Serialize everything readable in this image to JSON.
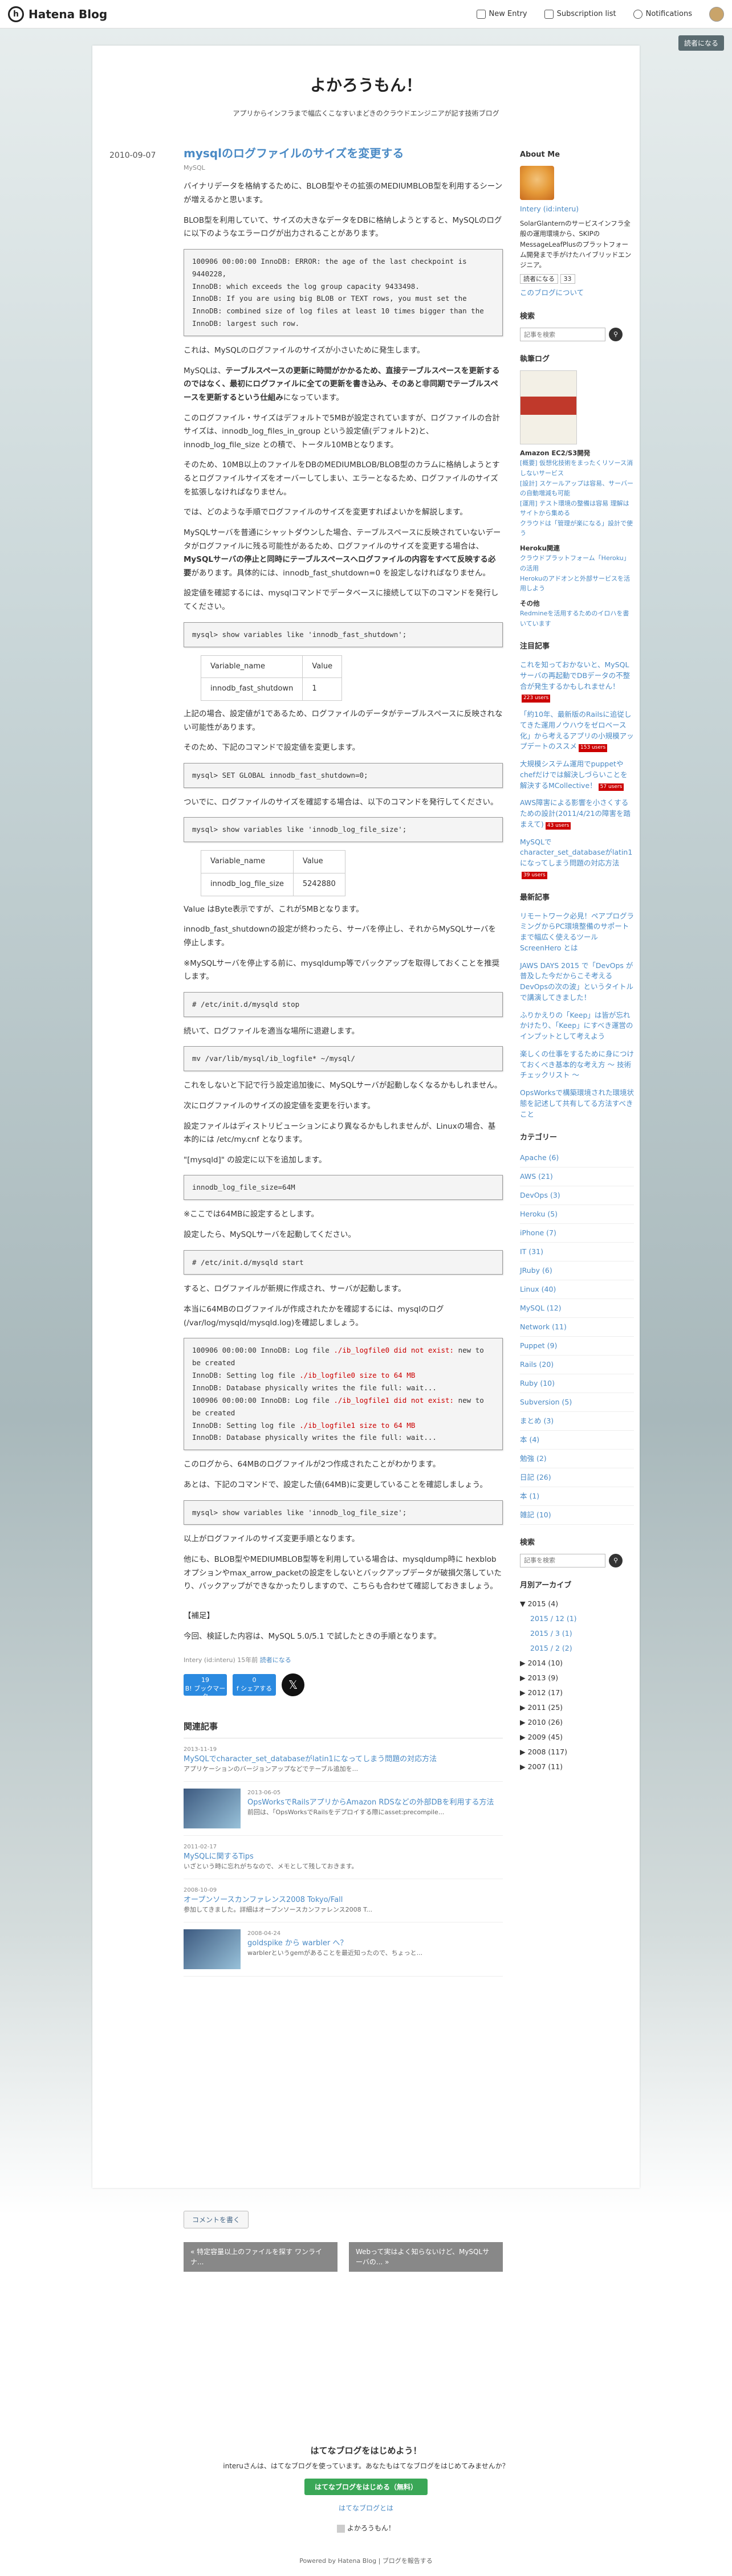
{
  "topbar": {
    "logo": "Hatena Blog",
    "new_entry": "New Entry",
    "subscription": "Subscription list",
    "notifications": "Notifications"
  },
  "read_button": "読者になる",
  "blog": {
    "title": "よかろうもん！",
    "description": "アプリからインフラまで幅広くこなすいまどきのクラウドエンジニアが記す技術ブログ"
  },
  "entry": {
    "date": "2010-09-07",
    "title": "mysqlのログファイルのサイズを変更する",
    "category": "MySQL",
    "p1": "バイナリデータを格納するために、BLOB型やその拡張のMEDIUMBLOB型を利用するシーンが増えるかと思います。",
    "p2": "BLOB型を利用していて、サイズの大きなデータをDBに格納しようとすると、MySQLのログに以下のようなエラーログが出力されることがあります。",
    "code1": [
      "100906 00:00:00 InnoDB: ERROR: the age of the last checkpoint is 9440228,",
      "InnoDB: which exceeds the log group capacity 9433498.",
      "InnoDB: If you are using big BLOB or TEXT rows, you must set the",
      "InnoDB: combined size of log files at least 10 times bigger than the",
      "InnoDB: largest such row."
    ],
    "p3": "これは、MySQLのログファイルのサイズが小さいために発生します。",
    "p4a": "MySQLは、",
    "p4b": "テーブルスペースの更新に時間がかかるため、直接テーブルスペースを更新するのではなく、最初にログファイルに全ての更新を書き込み、そのあと非同期でテーブルスペースを更新するという仕組み",
    "p4c": "になっています。",
    "p5": "このログファイル・サイズはデフォルトで5MBが設定されていますが、ログファイルの合計サイズは、innodb_log_files_in_group という設定値(デフォルト2)と、innodb_log_file_size との積で、トータル10MBとなります。",
    "p6": "そのため、10MB以上のファイルをDBのMEDIUMBLOB/BLOB型のカラムに格納しようとするとログファイルサイズをオーバーしてしまい、エラーとなるため、ログファイルのサイズを拡張しなければなりません。",
    "p7": "では、どのような手順でログファイルのサイズを変更すればよいかを解説します。",
    "p8a": "MySQLサーバを普通にシャットダウンした場合、テーブルスペースに反映されていないデータがログファイルに残る可能性があるため、ログファイルのサイズを変更する場合は、",
    "p8b": "MySQLサーバの停止と同時にテーブルスペースへログファイルの内容をすべて反映する必要",
    "p8c": "があります。具体的には、innodb_fast_shutdown=0 を設定しなければなりません。",
    "p9": "設定値を確認するには、mysqlコマンドでデータベースに接続して以下のコマンドを発行してください。",
    "code2": "mysql> show variables like 'innodb_fast_shutdown';",
    "table1": [
      [
        "Variable_name",
        "Value"
      ],
      [
        "innodb_fast_shutdown",
        "1"
      ]
    ],
    "p10": "上記の場合、設定値が1であるため、ログファイルのデータがテーブルスペースに反映されない可能性があります。",
    "p11": "そのため、下記のコマンドで設定値を変更します。",
    "code3": "mysql> SET GLOBAL innodb_fast_shutdown=0;",
    "p12": "ついでに、ログファイルのサイズを確認する場合は、以下のコマンドを発行してください。",
    "code4": "mysql> show variables like 'innodb_log_file_size';",
    "table2": [
      [
        "Variable_name",
        "Value"
      ],
      [
        "innodb_log_file_size",
        "5242880"
      ]
    ],
    "p13": "Value はByte表示ですが、これが5MBとなります。",
    "p14": "innodb_fast_shutdownの設定が終わったら、サーバを停止し、それからMySQLサーバを停止します。",
    "p15": "※MySQLサーバを停止する前に、mysqldump等でバックアップを取得しておくことを推奨します。",
    "code5": "# /etc/init.d/mysqld stop",
    "p16": "続いて、ログファイルを適当な場所に退避します。",
    "code6": "mv /var/lib/mysql/ib_logfile* ~/mysql/",
    "p17": "これをしないと下記で行う設定追加後に、MySQLサーバが起動しなくなるかもしれません。",
    "p18": "次にログファイルのサイズの設定値を変更を行います。",
    "p19": "設定ファイルはディストリビューションにより異なるかもしれませんが、Linuxの場合、基本的には /etc/my.cnf となります。",
    "p20": "\"[mysqld]\" の設定に以下を追加します。",
    "code7": "innodb_log_file_size=64M",
    "p21": "※ここでは64MBに設定するとします。",
    "p22": "設定したら、MySQLサーバを起動してください。",
    "code8": "# /etc/init.d/mysqld start",
    "p23": "すると、ログファイルが新規に作成され、サーバが起動します。",
    "p24": "本当に64MBのログファイルが作成されたかを確認するには、mysqlのログ(/var/log/mysqld/mysqld.log)を確認しましょう。",
    "code9": [
      {
        "a": "100906 00:00:00 InnoDB: Log file ",
        "e": "./ib_logfile0 did not exist:",
        "b": " new to be created"
      },
      {
        "a": "InnoDB: Setting log file ",
        "e": "./ib_logfile0 size to 64 MB",
        "b": ""
      },
      {
        "a": "InnoDB: Database physically writes the file full: wait...",
        "e": "",
        "b": ""
      },
      {
        "a": "100906 00:00:00 InnoDB: Log file ",
        "e": "./ib_logfile1 did not exist:",
        "b": " new to be created"
      },
      {
        "a": "InnoDB: Setting log file ",
        "e": "./ib_logfile1 size to 64 MB",
        "b": ""
      },
      {
        "a": "InnoDB: Database physically writes the file full: wait...",
        "e": "",
        "b": ""
      }
    ],
    "p25": "このログから、64MBのログファイルが2つ作成されたことがわかります。",
    "p26": "あとは、下記のコマンドで、設定した値(64MB)に変更していることを確認しましょう。",
    "code10": "mysql> show variables like 'innodb_log_file_size';",
    "p27": "以上がログファイルのサイズ変更手順となります。",
    "p28": "他にも、BLOB型やMEDIUMBLOB型等を利用している場合は、mysqldump時に hexblobオプションやmax_arrow_packetの設定をしないとバックアップデータが破損欠落していたり、バックアップができなかったりしますので、こちらも合わせて確認しておきましょう。",
    "note_h": "【補足】",
    "note": "今回、検証した内容は、MySQL 5.0/5.1 で試したときの手順となります。",
    "meta": "Intery (id:interu) 15年前",
    "meta_link": "読者になる",
    "share": [
      {
        "c": "19",
        "l": "B! ブックマーク"
      },
      {
        "c": "0",
        "l": "f シェアする"
      }
    ],
    "x_label": "𝕏"
  },
  "related": {
    "heading": "関連記事",
    "items": [
      {
        "d": "2013-11-19",
        "t": "MySQLでcharacter_set_databaseがlatin1になってしまう問題の対応方法",
        "s": "アプリケーションのバージョンアップなどでテーブル追加を..."
      },
      {
        "d": "2013-06-05",
        "t": "OpsWorksでRailsアプリからAmazon RDSなどの外部DBを利用する方法",
        "s": "前回は、「OpsWorksでRailsをデプロイする際にasset:precompile..."
      },
      {
        "d": "2011-02-17",
        "t": "MySQLに関するTips",
        "s": "いざという時に忘れがちなので、メモとして残しておきます。"
      },
      {
        "d": "2008-10-09",
        "t": "オープンソースカンファレンス2008 Tokyo/Fall",
        "s": "参加してきました。詳細はオープンソースカンファレンス2008 T..."
      },
      {
        "d": "2008-04-24",
        "t": "goldspike から warbler へ？",
        "s": "warblerというgemがあることを最近知ったので、ちょっと..."
      }
    ]
  },
  "comment_btn": "コメントを書く",
  "pager": {
    "prev": "« 特定容量以上のファイルを探す ワンライナ...",
    "next": "Webって実はよく知らないけど、MySQLサーバの... »"
  },
  "side": {
    "about_h": "About Me",
    "about_name": "Intery (id:interu)",
    "about_text": "SolarGlanternのサービスインフラ全般の運用環境から、SKIPのMessageLeafPlusのプラットフォーム開発まで手がけたハイブリッドエンジニア。",
    "reader_label": "読者になる",
    "reader_count": "33",
    "about_link": "このブログについて",
    "search_h": "検索",
    "search_ph": "記事を検索",
    "books_h": "執筆ログ",
    "book_title": "Amazon EC2/S3開発",
    "book_notes": [
      "[概要] 仮想化技術をまったくリソース消しないサービス",
      "[設計] スケールアップは容易、サーバーの自動増減も可能",
      "[運用] テスト環境の整備は容易 理解はサイトから集める",
      "クラウドは「管理が楽になる」設計で使う"
    ],
    "heroku_h": "Heroku関連",
    "heroku_notes": [
      "クラウドプラットフォーム「Heroku」の活用",
      "Herokuのアドオンと外部サービスを活用しよう"
    ],
    "other_h": "その他",
    "other_notes": [
      "Redmineを活用するためのイロハを書いています"
    ],
    "feat_h": "注目記事",
    "feat": [
      {
        "t": "これを知っておかないと、MySQLサーバの再起動でDBデータの不整合が発生するかもしれません！",
        "b": "223 users"
      },
      {
        "t": "「約10年、最新版のRailsに追従してきた運用ノウハウをゼロベース化」から考えるアプリの小規模アップデートのススメ",
        "b": "153 users"
      },
      {
        "t": "大規模システム運用でpuppetやchefだけでは解決しづらいことを解決するMCollective！",
        "b": "57 users"
      },
      {
        "t": "AWS障害による影響を小さくするための設計(2011/4/21の障害を踏まえて)",
        "b": "43 users"
      },
      {
        "t": "MySQLでcharacter_set_databaseがlatin1になってしまう問題の対応方法",
        "b": "39 users"
      }
    ],
    "recent_h": "最新記事",
    "recent": [
      "リモートワーク必見！ペアプログラミングからPC環境整備のサポートまで幅広く使えるツール ScreenHero とは",
      "JAWS DAYS 2015 で「DevOps が普及した今だからこそ考えるDevOpsの次の波」というタイトルで講演してきました！",
      "ふりかえりの「Keep」は皆が忘れかけたり、「Keep」にすべき運営のインプットとして考えよう",
      "楽しくの仕事をするために身につけておくべき基本的な考え方 〜 技術チェックリスト 〜",
      "OpsWorksで構築環境された環境状態を記述して共有してる方法すべきこと"
    ],
    "cat_h": "カテゴリー",
    "cats": [
      "Apache (6)",
      "AWS (21)",
      "DevOps (3)",
      "Heroku (5)",
      "iPhone (7)",
      "IT (31)",
      "JRuby (6)",
      "Linux (40)",
      "MySQL (12)",
      "Network (11)",
      "Puppet (9)",
      "Rails (20)",
      "Ruby (10)",
      "Subversion (5)",
      "まとめ (3)",
      "本 (4)",
      "勉強 (2)",
      "日記 (26)",
      "本 (1)",
      "雑記 (10)"
    ],
    "search2_h": "検索",
    "arch_h": "月別アーカイブ",
    "arch": [
      "▼ 2015 (4)",
      "2015 / 12 (1)",
      "2015 / 3 (1)",
      "2015 / 2 (2)",
      "▶ 2014 (10)",
      "▶ 2013 (9)",
      "▶ 2012 (17)",
      "▶ 2011 (25)",
      "▶ 2010 (26)",
      "▶ 2009 (45)",
      "▶ 2008 (117)",
      "▶ 2007 (11)"
    ]
  },
  "bottom": {
    "h": "はてなブログをはじめよう！",
    "t": "interuさんは、はてなブログを使っています。あなたもはてなブログをはじめてみませんか？",
    "btn": "はてなブログをはじめる（無料）",
    "about": "はてなブログとは",
    "self": "よかろうもん！",
    "credit": "Powered by Hatena Blog | ブログを報告する"
  }
}
